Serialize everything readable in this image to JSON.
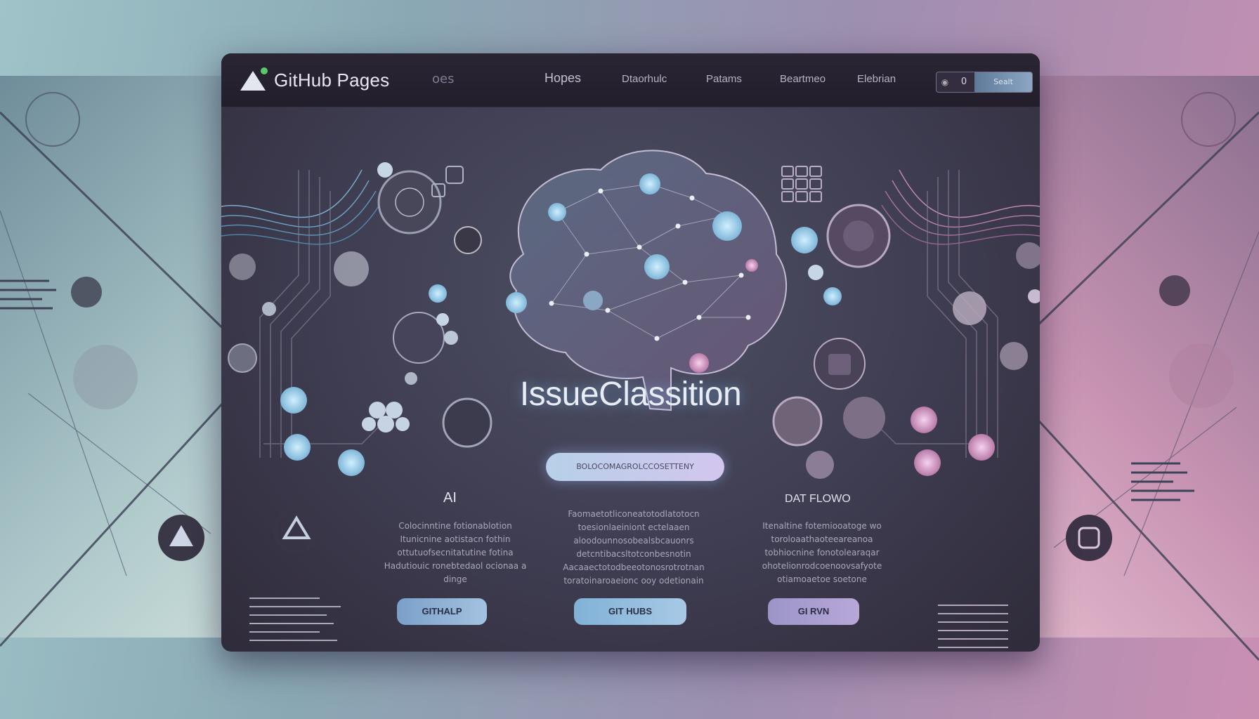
{
  "brand": {
    "name": "GitHub Pages",
    "ghost_label": "oes"
  },
  "nav": {
    "items": [
      "Hopes",
      "Dtaorhulc",
      "Patams",
      "Beartmeo",
      "Elebrian"
    ]
  },
  "search": {
    "icon": "search-icon",
    "value": "0",
    "button_label": "Sealt"
  },
  "hero": {
    "title": "IssueClassition",
    "cta_label": "BOLOCOMAGROLCCOSETTENY"
  },
  "columns": [
    {
      "title": "AI",
      "text": "Colocinntine fotionablotion Itunicnine aotistacn fothin ottutuofsecnitatutine fotina Hadutiouic ronebtedaol ocionaa a dinge",
      "button_label": "GITHALP"
    },
    {
      "title": "",
      "text": "Faomaetotliconeatotodlatotocn toesionlaeiniont ectelaaen aloodounnosobealsbcauonrs detcntibacsltotconbesnotin Aacaaectotodbeeotonosrotrotnan toratoinaroaeionc ooy odetionain",
      "button_label": "GIT HUBS"
    },
    {
      "title": "DAT FLOWO",
      "text": "Itenaltine fotemiooatoge wo toroloaathaoteeareanoa tobhiocnine fonotolearaqar ohotelionrodcoenoovsafyote otiamoaetoe soetone",
      "button_label": "GI RVN"
    }
  ],
  "colors": {
    "accent_cyan": "#9fd6ff",
    "accent_pink": "#e39bc6",
    "panel": "#3e3c50"
  }
}
